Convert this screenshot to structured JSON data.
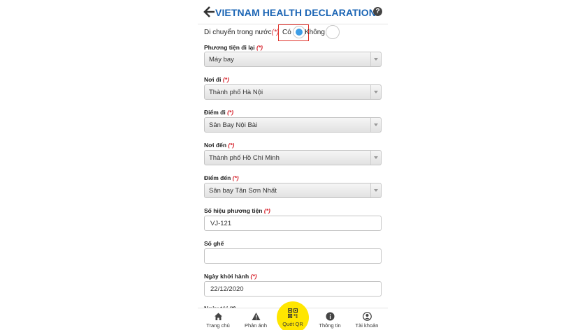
{
  "header": {
    "title": "VIETNAM HEALTH DECLARATION"
  },
  "domestic_travel": {
    "label": "Di chuyển trong nước",
    "required_mark": "(*)",
    "option_yes": "Có",
    "option_no": "Không",
    "selected": "Có"
  },
  "fields": {
    "vehicle": {
      "label": "Phương tiện đi lại",
      "required_mark": "(*)",
      "value": "Máy bay"
    },
    "from_city": {
      "label": "Nơi đi",
      "required_mark": "(*)",
      "value": "Thành phố Hà Nội"
    },
    "from_point": {
      "label": "Điểm đi",
      "required_mark": "(*)",
      "value": "Sân Bay Nội Bài"
    },
    "to_city": {
      "label": "Nơi đến",
      "required_mark": "(*)",
      "value": "Thành phố Hồ Chí Minh"
    },
    "to_point": {
      "label": "Điểm đến",
      "required_mark": "(*)",
      "value": "Sân bay Tân Sơn Nhất"
    },
    "vehicle_no": {
      "label": "Số hiệu phương tiện",
      "required_mark": "(*)",
      "value": "VJ-121"
    },
    "seat_no": {
      "label": "Số ghế",
      "value": ""
    },
    "depart_date": {
      "label": "Ngày khởi hành",
      "required_mark": "(*)",
      "value": "22/12/2020"
    }
  },
  "partial_label": "Ngày tới (*)",
  "tabbar": {
    "home": "Trang chủ",
    "feedback": "Phản ánh",
    "scan_qr": "Quét QR",
    "info": "Thông tin",
    "account": "Tài khoản"
  },
  "colors": {
    "brand": "#1a64b4",
    "accent_yellow": "#ffe600",
    "radio_selected": "#3d9de6",
    "required": "#d6202a",
    "highlight_box": "#e0342c"
  }
}
